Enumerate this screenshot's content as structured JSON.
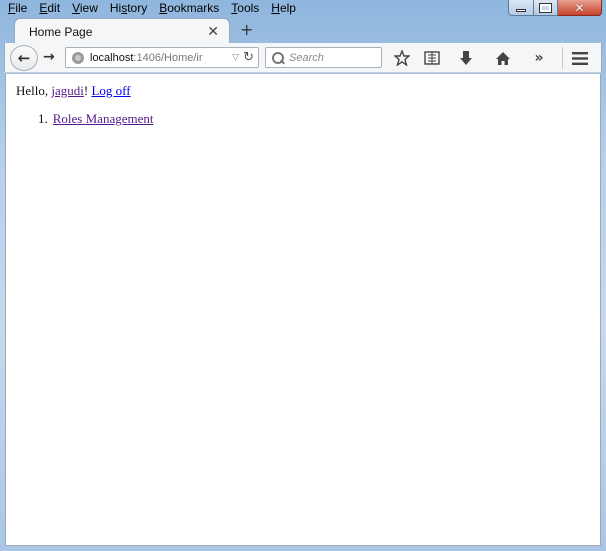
{
  "menu": {
    "items": [
      {
        "first": "F",
        "rest": "ile"
      },
      {
        "first": "E",
        "rest": "dit"
      },
      {
        "first": "V",
        "rest": "iew"
      },
      {
        "first": "Hi",
        "ul": "s",
        "rest": "tory"
      },
      {
        "first": "B",
        "rest": "ookmarks"
      },
      {
        "first": "T",
        "rest": "ools"
      },
      {
        "first": "H",
        "rest": "elp"
      }
    ]
  },
  "window_controls": {
    "minimize": "",
    "maximize": "",
    "close": "✕"
  },
  "tab": {
    "title": "Home Page",
    "close": "✕",
    "new_tab": "+"
  },
  "nav": {
    "back": "←",
    "forward": "→",
    "url_host": "localhost",
    "url_rest": ":1406/Home/ir",
    "url_dropdown": "▽",
    "reload": "↻",
    "search_placeholder": "Search",
    "icons": [
      "star-icon",
      "reader-icon",
      "download-icon",
      "home-icon",
      "overflow-icon",
      "menu-icon"
    ]
  },
  "content": {
    "greeting_prefix": "Hello, ",
    "username": "jagudi",
    "greeting_suffix": "! ",
    "logoff": "Log off",
    "list": [
      {
        "num": "1.",
        "label": "Roles Management"
      }
    ]
  },
  "colors": {
    "visited_link": "#551a8b",
    "link": "#0000ee",
    "chrome": "#f5f6f7"
  }
}
